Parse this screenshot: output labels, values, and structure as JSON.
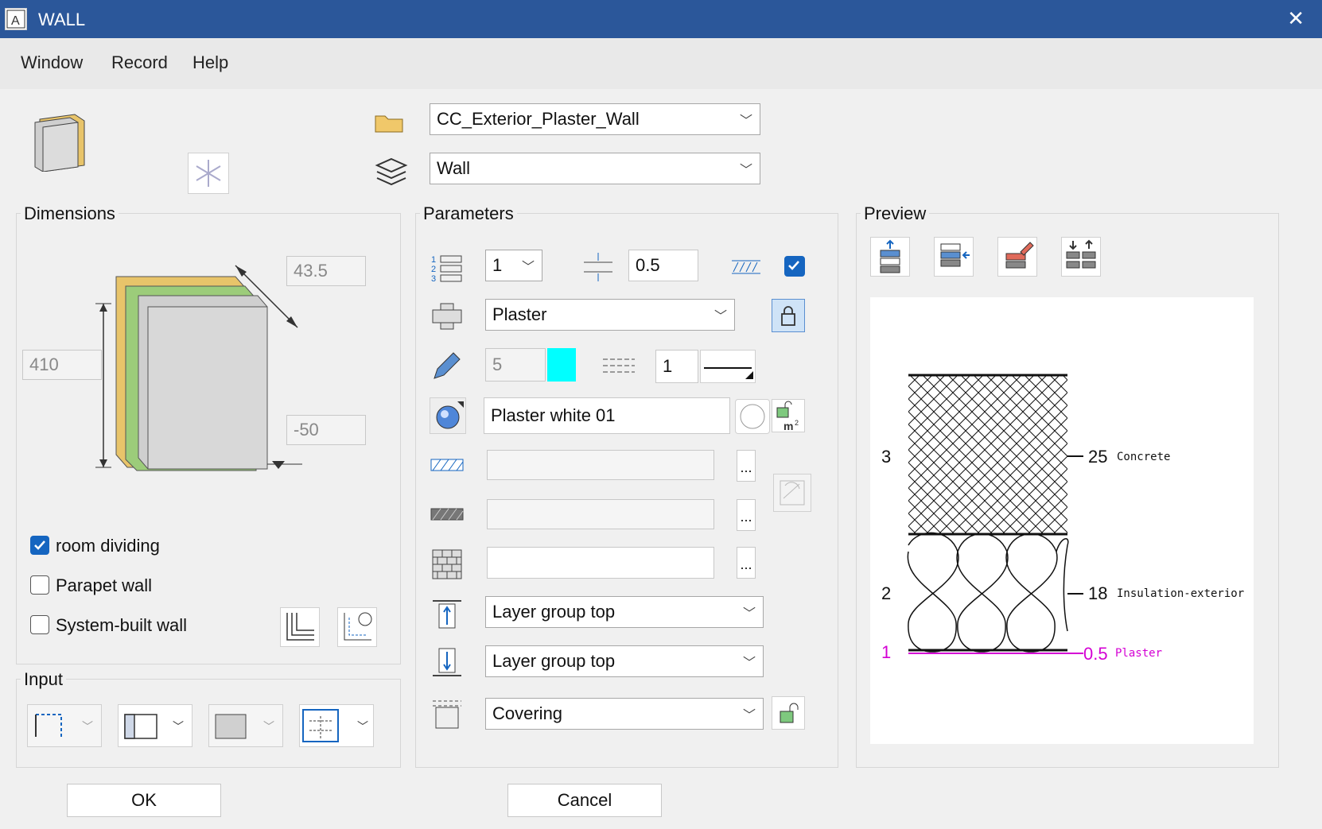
{
  "window": {
    "title": "WALL"
  },
  "menu": [
    "Window",
    "Record",
    "Help"
  ],
  "favorite": {
    "value": "CC_Exterior_Plaster_Wall"
  },
  "element_type": {
    "value": "Wall"
  },
  "dimensions": {
    "label": "Dimensions",
    "thickness": "43.5",
    "height": "410",
    "offset": "-50"
  },
  "checkboxes": [
    {
      "label": "room dividing",
      "checked": true
    },
    {
      "label": "Parapet wall",
      "checked": false
    },
    {
      "label": "System-built wall",
      "checked": false
    }
  ],
  "input": {
    "label": "Input"
  },
  "parameters": {
    "label": "Parameters",
    "layer_number": "1",
    "layer_thickness": "0.5",
    "material": "Plaster",
    "pen": "5",
    "line": "1",
    "surface": "Plaster white 01",
    "pattern_text": "",
    "top_ref": "Layer group top",
    "bottom_ref": "Layer group top",
    "covering": "Covering"
  },
  "preview": {
    "label": "Preview",
    "layers": [
      {
        "number": "3",
        "thickness": "25",
        "material": "Concrete"
      },
      {
        "number": "2",
        "thickness": "18",
        "material": "Insulation-exterior"
      },
      {
        "number": "1",
        "thickness": "0.5",
        "material": "Plaster"
      }
    ]
  },
  "buttons": {
    "ok": "OK",
    "cancel": "Cancel"
  },
  "colors": {
    "titlebar": "#2b579a",
    "accent": "#1565c0",
    "cyan": "#00ffff",
    "highlight_layer": "#d400d4"
  }
}
